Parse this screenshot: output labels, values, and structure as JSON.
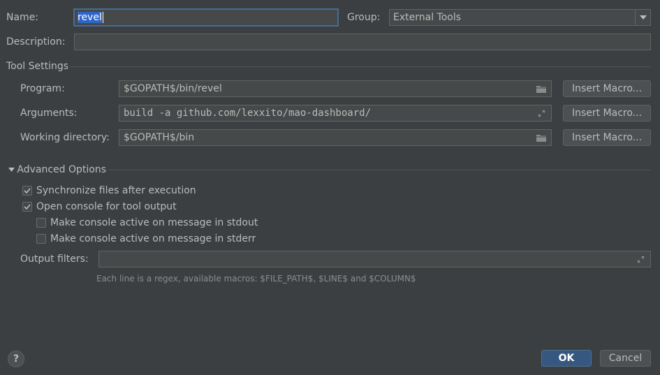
{
  "name": {
    "label": "Name:",
    "value": "revel"
  },
  "group": {
    "label": "Group:",
    "value": "External Tools"
  },
  "description": {
    "label": "Description:",
    "value": ""
  },
  "tool_settings": {
    "title": "Tool Settings",
    "program": {
      "label": "Program:",
      "value": "$GOPATH$/bin/revel"
    },
    "arguments": {
      "label": "Arguments:",
      "value": "build -a github.com/lexxito/mao-dashboard/"
    },
    "working_directory": {
      "label": "Working directory:",
      "value": "$GOPATH$/bin"
    },
    "insert_macro_label": "Insert Macro..."
  },
  "advanced": {
    "title": "Advanced Options",
    "options": [
      {
        "label": "Synchronize files after execution",
        "checked": true
      },
      {
        "label": "Open console for tool output",
        "checked": true
      },
      {
        "label": "Make console active on message in stdout",
        "checked": false
      },
      {
        "label": "Make console active on message in stderr",
        "checked": false
      }
    ],
    "output_filters": {
      "label": "Output filters:",
      "value": ""
    },
    "hint": "Each line is a regex, available macros: $FILE_PATH$, $LINE$ and $COLUMN$"
  },
  "footer": {
    "help": "?",
    "ok": "OK",
    "cancel": "Cancel"
  }
}
